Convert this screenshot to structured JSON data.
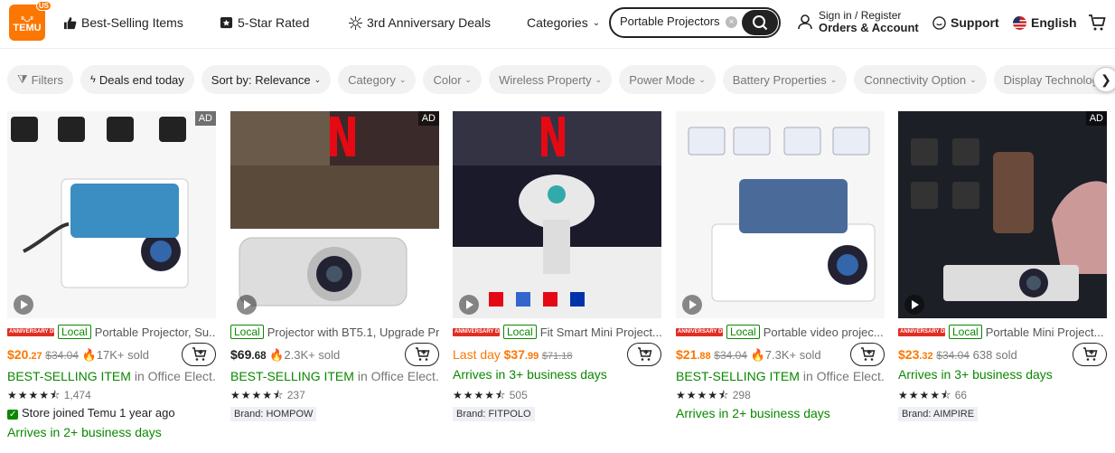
{
  "header": {
    "logo_text": "TEMU",
    "logo_region": "US",
    "nav": [
      "Best-Selling Items",
      "5-Star Rated",
      "3rd Anniversary Deals",
      "Categories"
    ],
    "search_value": "Portable Projectors",
    "sign_in": "Sign in / Register",
    "orders": "Orders & Account",
    "support": "Support",
    "language": "English"
  },
  "filters": [
    "Filters",
    "Deals end today",
    "Sort by: Relevance",
    "Category",
    "Color",
    "Wireless Property",
    "Power Mode",
    "Battery Properties",
    "Connectivity Option",
    "Display Technology"
  ],
  "products": [
    {
      "ad": "AD",
      "anniv": "ANNIVERSARY DEALS",
      "local": "Local",
      "title": "Portable Projector, Su...",
      "price_int": "$20",
      "price_dec": ".27",
      "old": "$34.04",
      "sold": "17K+ sold",
      "badge": "BEST-SELLING ITEM",
      "badge_rest": " in Office Elect...",
      "stars": "★★★★⯪",
      "reviews": "1,474",
      "extra": "Store joined Temu 1 year ago",
      "extra2": "Arrives in 2+ business days"
    },
    {
      "ad": "AD",
      "anniv": "",
      "local": "Local",
      "title": "Projector with BT5.1, Upgrade Pr...",
      "price_int": "$69",
      "price_dec": ".68",
      "old": "",
      "sold": "2.3K+ sold",
      "badge": "BEST-SELLING ITEM",
      "badge_rest": " in Office Elect...",
      "stars": "★★★★⯪",
      "reviews": "237",
      "brand": "Brand: HOMPOW"
    },
    {
      "ad": "",
      "anniv": "ANNIVERSARY DEALS",
      "local": "Local",
      "title": "Fit Smart Mini Project...",
      "lastday": "Last day",
      "price_int": "$37",
      "price_dec": ".99",
      "old": "$71.18",
      "sold": "",
      "badge": "",
      "badge_rest": "Arrives in 3+ business days",
      "stars": "★★★★⯪",
      "reviews": "505",
      "brand": "Brand: FITPOLO"
    },
    {
      "ad": "",
      "anniv": "ANNIVERSARY DEALS",
      "local": "Local",
      "title": "Portable video projec...",
      "price_int": "$21",
      "price_dec": ".88",
      "old": "$34.04",
      "sold": "7.3K+ sold",
      "badge": "BEST-SELLING ITEM",
      "badge_rest": " in Office Elect...",
      "stars": "★★★★⯪",
      "reviews": "298",
      "extra2": "Arrives in 2+ business days"
    },
    {
      "ad": "AD",
      "anniv": "ANNIVERSARY DEALS",
      "local": "Local",
      "title": "Portable Mini Project...",
      "price_int": "$23",
      "price_dec": ".32",
      "old": "$34.04",
      "sold": "638 sold",
      "badge": "",
      "badge_rest": "Arrives in 3+ business days",
      "stars": "★★★★⯪",
      "reviews": "66",
      "brand": "Brand: AIMPIRE"
    }
  ]
}
